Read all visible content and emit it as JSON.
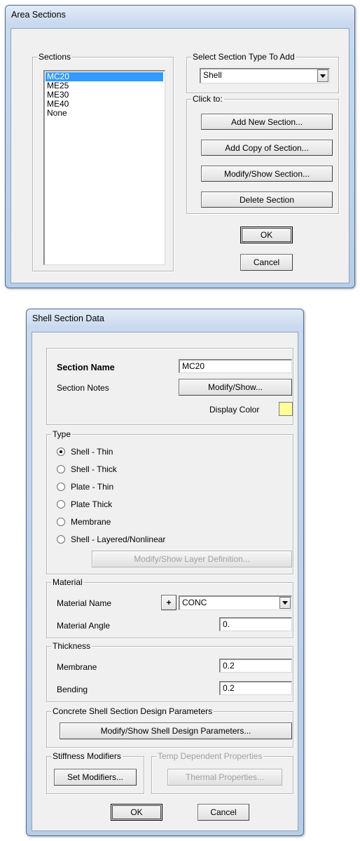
{
  "area_sections": {
    "title": "Area Sections",
    "sections_group_label": "Sections",
    "sections": [
      "MC20",
      "ME25",
      "ME30",
      "ME40",
      "None"
    ],
    "selected_section_index": 0,
    "select_type_label": "Select Section Type To Add",
    "section_type_value": "Shell",
    "click_to_label": "Click to:",
    "add_new_label": "Add New Section...",
    "add_copy_label": "Add Copy of Section...",
    "modify_show_label": "Modify/Show Section...",
    "delete_label": "Delete Section",
    "ok_label": "OK",
    "cancel_label": "Cancel"
  },
  "shell_section_data": {
    "title": "Shell Section Data",
    "section_name_label": "Section Name",
    "section_name_value": "MC20",
    "section_notes_label": "Section Notes",
    "modify_show_notes_label": "Modify/Show...",
    "display_color_label": "Display Color",
    "display_color": "#ffff99",
    "type_group_label": "Type",
    "types": [
      "Shell - Thin",
      "Shell - Thick",
      "Plate - Thin",
      "Plate Thick",
      "Membrane",
      "Shell - Layered/Nonlinear"
    ],
    "selected_type_index": 0,
    "layer_definition_label": "Modify/Show Layer Definition...",
    "material_group_label": "Material",
    "material_name_label": "Material Name",
    "add_material_label": "+",
    "material_name_value": "CONC",
    "material_angle_label": "Material Angle",
    "material_angle_value": "0.",
    "thickness_group_label": "Thickness",
    "membrane_label": "Membrane",
    "membrane_value": "0.2",
    "bending_label": "Bending",
    "bending_value": "0.2",
    "design_group_label": "Concrete Shell Section Design Parameters",
    "design_params_label": "Modify/Show Shell Design Parameters...",
    "stiffness_group_label": "Stiffness Modifiers",
    "set_modifiers_label": "Set Modifiers...",
    "temp_group_label": "Temp Dependent Properties",
    "thermal_label": "Thermal Properties...",
    "ok_label": "OK",
    "cancel_label": "Cancel"
  }
}
